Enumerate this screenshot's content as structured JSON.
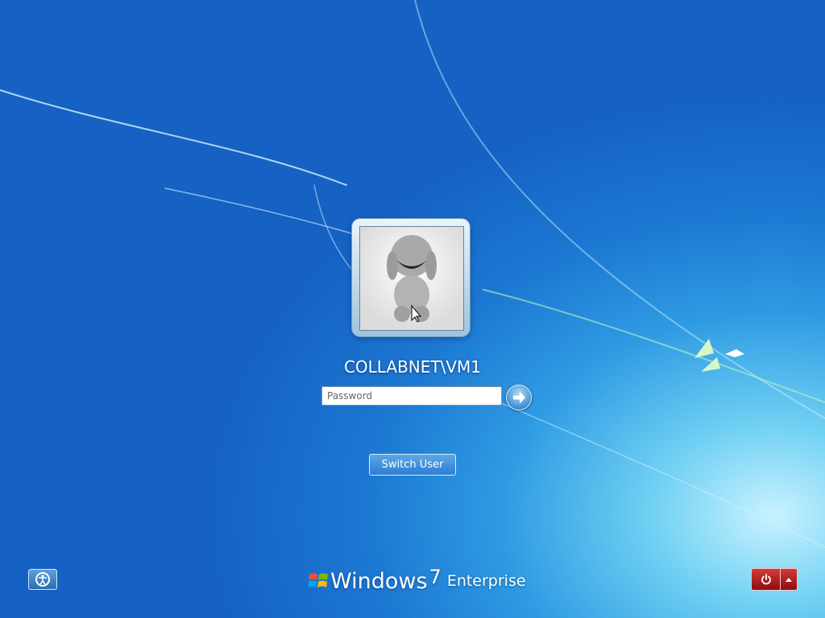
{
  "login": {
    "user_name": "COLLABNET\\VM1",
    "password_placeholder": "Password",
    "switch_user_label": "Switch User"
  },
  "branding": {
    "product": "Windows",
    "version": "7",
    "edition": "Enterprise"
  },
  "icons": {
    "submit": "arrow-right-icon",
    "ease_of_access": "ease-of-access-icon",
    "power": "power-icon",
    "power_options": "triangle-up-icon",
    "logo": "windows-flag-icon"
  },
  "colors": {
    "background_deep": "#1562c4",
    "background_light": "#c8f2ff",
    "power_button": "#b01e1e",
    "button_blue": "#3a87d6"
  }
}
